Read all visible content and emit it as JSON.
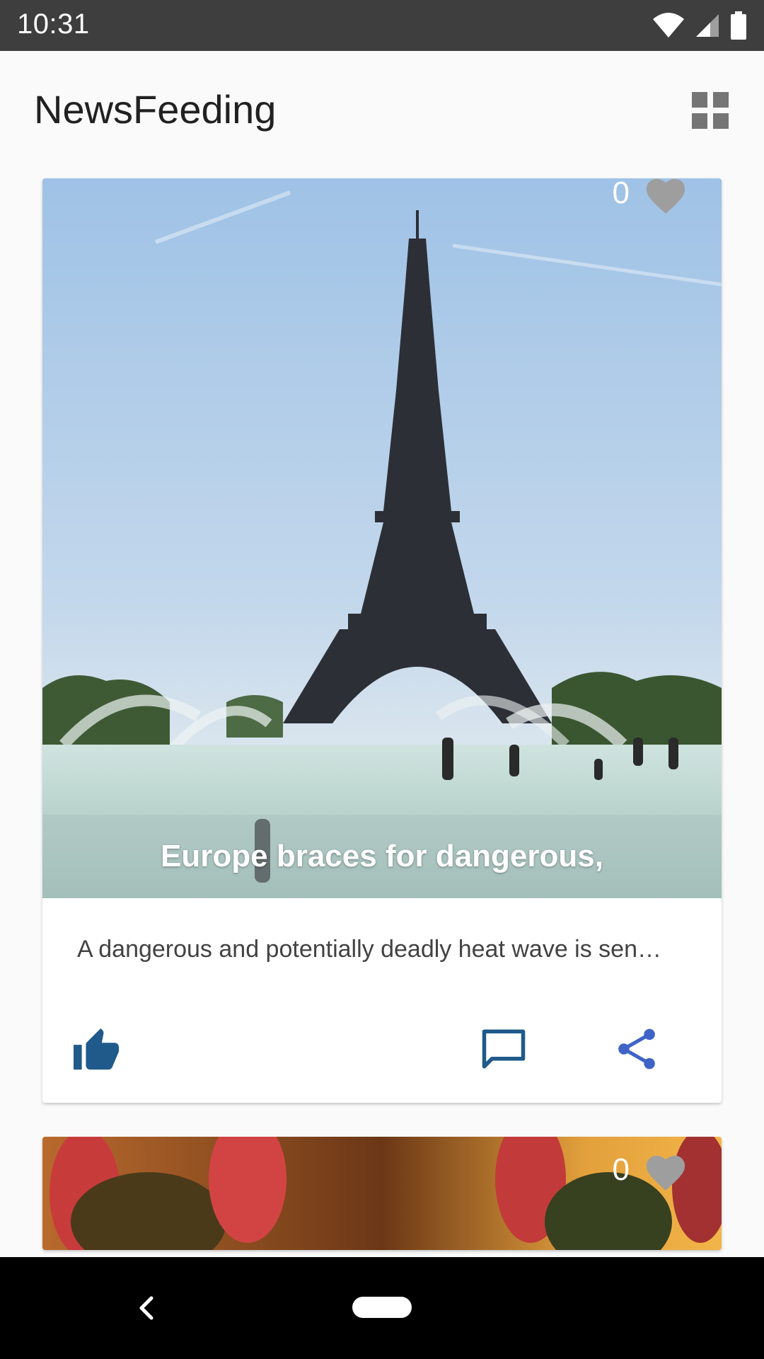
{
  "status_bar": {
    "time": "10:31"
  },
  "app_bar": {
    "title": "NewsFeeding",
    "grid_icon": "grid-view-icon"
  },
  "feed": [
    {
      "likes": "0",
      "caption": "Europe braces for dangerous,",
      "summary": "A dangerous and potentially deadly heat wave is sen…",
      "image": "eiffel-tower-fountain-photo"
    },
    {
      "likes": "0",
      "image": "gas-masks-photo"
    }
  ],
  "actions": {
    "like_icon": "thumbs-up-icon",
    "comment_icon": "comment-icon",
    "share_icon": "share-icon"
  },
  "colors": {
    "accent": "#1f5a8a",
    "share": "#3f63c7",
    "status_bar": "#3e3e3e"
  }
}
